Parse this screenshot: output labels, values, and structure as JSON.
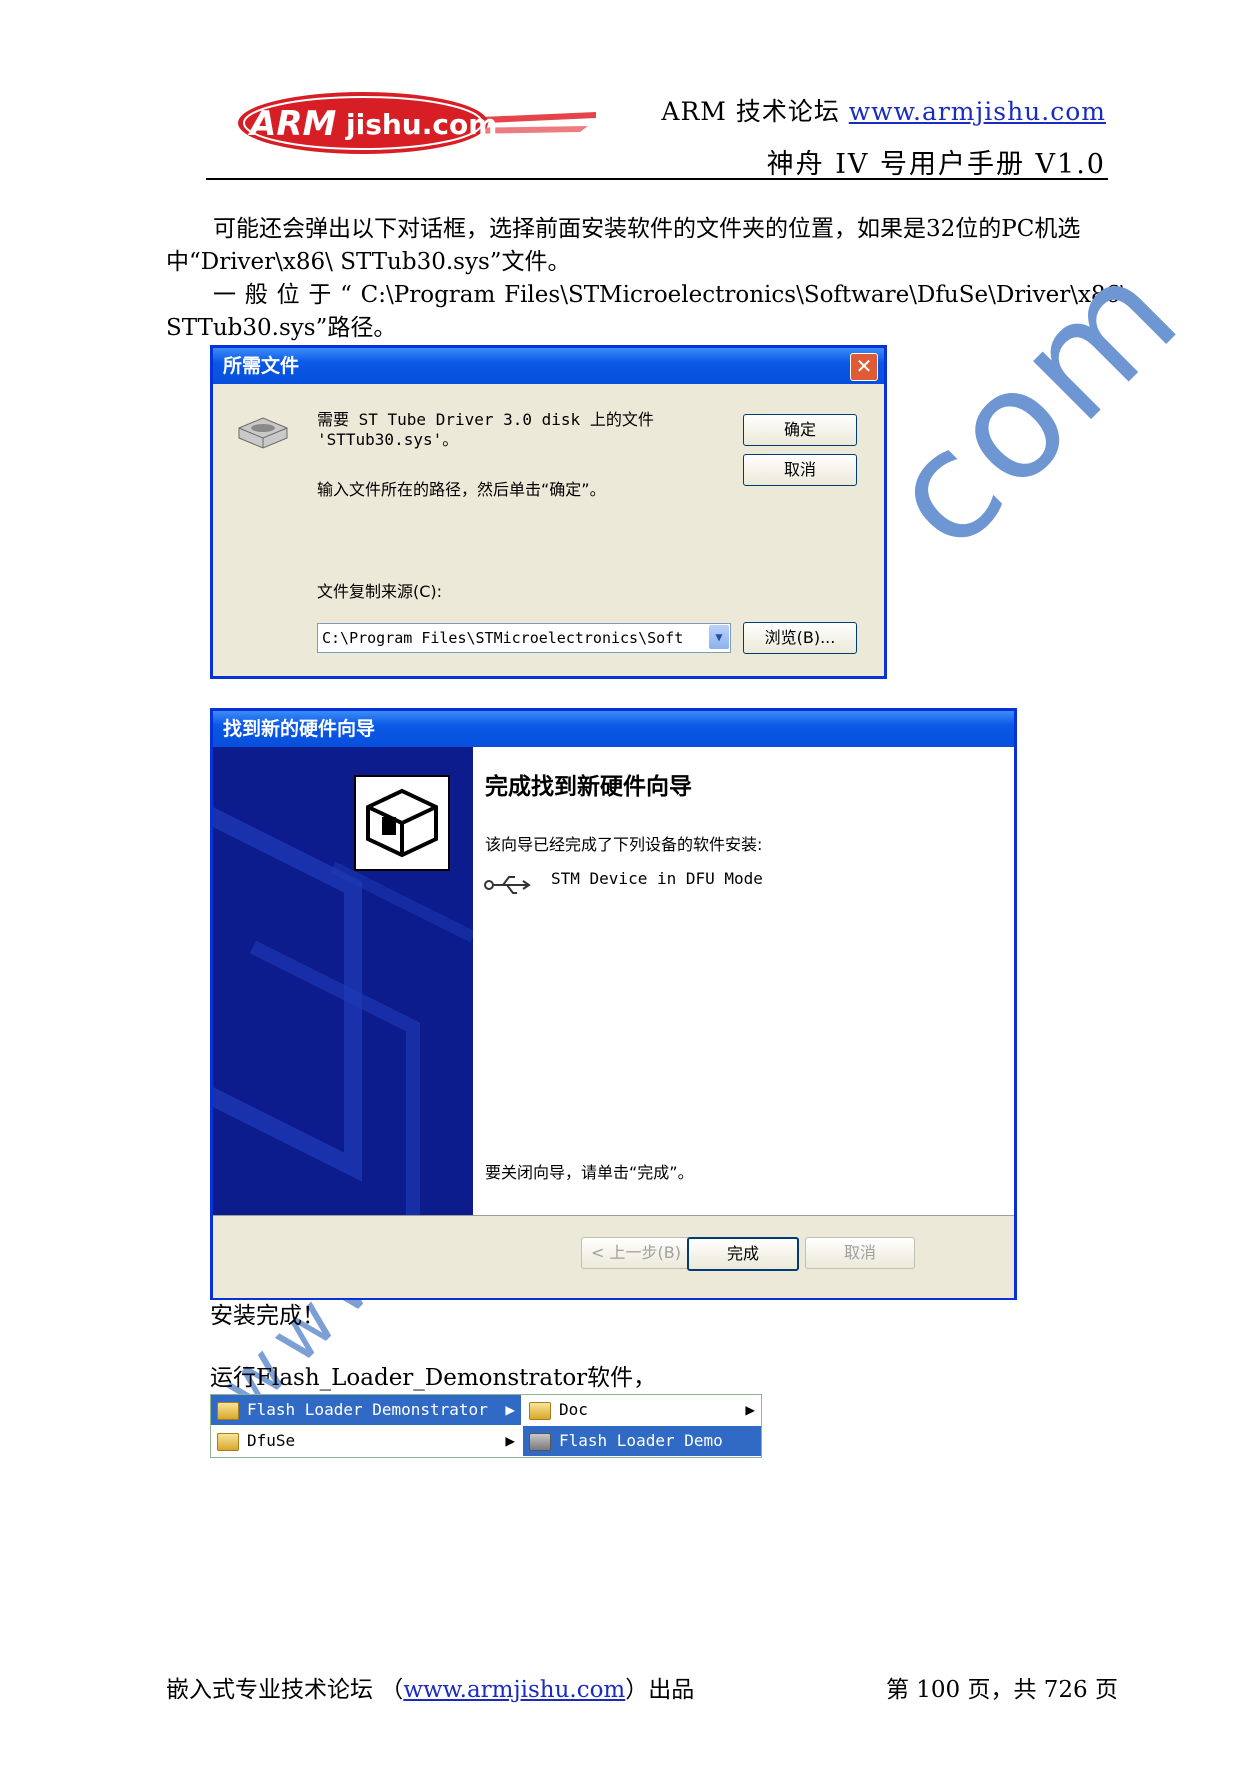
{
  "header": {
    "logo_text": "ARMjishu.com",
    "site_prefix": "ARM 技术论坛 ",
    "site_url": "www.armjishu.com",
    "manual_title": "神舟 IV 号用户手册  V1.0"
  },
  "body": {
    "paragraph1": "可能还会弹出以下对话框，选择前面安装软件的文件夹的位置，如果是32位的PC机选中“Driver\\x86\\ STTub30.sys”文件。",
    "paragraph2_words": [
      "一",
      "般",
      "位",
      "于",
      "“",
      "C:\\Program",
      "Files\\STMicroelectronics\\Software\\DfuSe\\Driver\\x86\\"
    ],
    "paragraph2_tail": "STTub30.sys”路径。",
    "install_done": "安装完成！",
    "run_text": "运行Flash_Loader_Demonstrator软件，"
  },
  "watermark": {
    "text": "com",
    "text2": "www"
  },
  "dialog1": {
    "title": "所需文件",
    "close_icon": "close-icon",
    "line1": "需要 ST Tube Driver 3.0 disk 上的文件",
    "line2": "'STTub30.sys'。",
    "instruction": "输入文件所在的路径，然后单击“确定”。",
    "source_label": "文件复制来源(C):",
    "path_value": "C:\\Program Files\\STMicroelectronics\\Soft",
    "ok_label": "确定",
    "cancel_label": "取消",
    "browse_label": "浏览(B)..."
  },
  "dialog2": {
    "title": "找到新的硬件向导",
    "heading": "完成找到新硬件向导",
    "completed_text": "该向导已经完成了下列设备的软件安装:",
    "device_name": "STM Device in DFU Mode",
    "close_hint": "要关闭向导，请单击“完成”。",
    "back_label": "< 上一步(B)",
    "finish_label": "完成",
    "cancel_label": "取消"
  },
  "menu": {
    "col1": [
      "Flash Loader Demonstrator",
      "DfuSe"
    ],
    "col2": [
      "Doc",
      "Flash Loader Demo"
    ]
  },
  "footer": {
    "left_prefix": "嵌入式专业技术论坛  （",
    "left_url": "www.armjishu.com",
    "left_suffix": "）出品",
    "page_info": "第 100 页，共 726 页"
  },
  "colors": {
    "title_blue": "#0a58e6",
    "link_blue": "#1a2bbf",
    "watermark": "#6e96d2",
    "dialog_bg": "#ece9d8"
  }
}
